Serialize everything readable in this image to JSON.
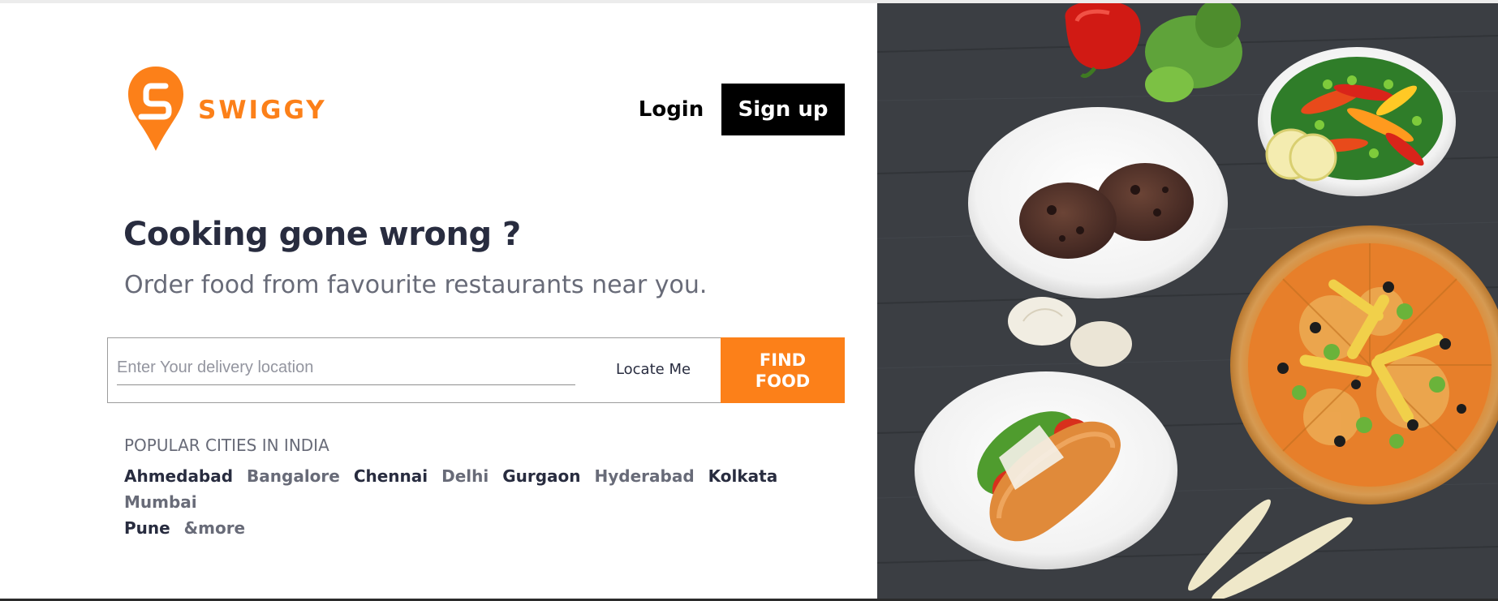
{
  "brand": {
    "name": "SWIGGY",
    "color": "#fc8019"
  },
  "header": {
    "login_label": "Login",
    "signup_label": "Sign up"
  },
  "hero": {
    "title": "Cooking gone wrong ?",
    "subtitle": "Order food from favourite restaurants near you."
  },
  "search": {
    "placeholder": "Enter Your delivery location",
    "value": "",
    "locate_label": "Locate Me",
    "find_line1": "FIND",
    "find_line2": "FOOD"
  },
  "popular": {
    "title": "POPULAR CITIES IN INDIA",
    "cities": [
      {
        "name": "Ahmedabad",
        "tone": "dark"
      },
      {
        "name": "Bangalore",
        "tone": "grey"
      },
      {
        "name": "Chennai",
        "tone": "dark"
      },
      {
        "name": "Delhi",
        "tone": "grey"
      },
      {
        "name": "Gurgaon",
        "tone": "dark"
      },
      {
        "name": "Hyderabad",
        "tone": "grey"
      },
      {
        "name": "Kolkata",
        "tone": "dark"
      },
      {
        "name": "Mumbai",
        "tone": "grey"
      },
      {
        "name": "Pune",
        "tone": "dark"
      },
      {
        "name": "&more",
        "tone": "grey"
      }
    ]
  },
  "hero_image": {
    "icon": "food-spread-photo",
    "items": [
      "red-pepper",
      "lettuce",
      "salad-bowl",
      "cookies-plate",
      "onions",
      "pizza",
      "sandwich-plate",
      "baby-corn"
    ]
  }
}
